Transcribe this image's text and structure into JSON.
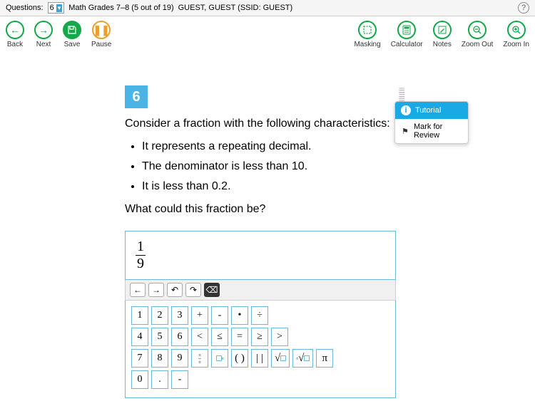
{
  "topbar": {
    "questions_label": "Questions:",
    "current_q": "6",
    "title": "Math Grades 7–8 (5 out of 19)",
    "user": "GUEST, GUEST (SSID: GUEST)"
  },
  "toolbar": {
    "back": "Back",
    "next": "Next",
    "save": "Save",
    "pause": "Pause",
    "masking": "Masking",
    "calculator": "Calculator",
    "notes": "Notes",
    "zoom_out": "Zoom Out",
    "zoom_in": "Zoom In"
  },
  "menu": {
    "tutorial": "Tutorial",
    "mark": "Mark for Review"
  },
  "question": {
    "number": "6",
    "intro": "Consider a fraction with the following characteristics:",
    "bullets": [
      "It represents a repeating decimal.",
      "The denominator is less than 10.",
      "It is less than 0.2."
    ],
    "prompt": "What could this fraction be?"
  },
  "answer": {
    "numerator": "1",
    "denominator": "9"
  },
  "keypad": {
    "row1": [
      "1",
      "2",
      "3",
      "+",
      "-",
      "•",
      "÷"
    ],
    "row2": [
      "4",
      "5",
      "6",
      "<",
      "≤",
      "=",
      "≥",
      ">"
    ],
    "row3_nums": [
      "7",
      "8",
      "9"
    ],
    "row3_ops": [
      "frac",
      "exp",
      "()",
      "abs",
      "sqrt",
      "nroot",
      "π"
    ],
    "row4": [
      "0",
      ".",
      "-"
    ]
  }
}
